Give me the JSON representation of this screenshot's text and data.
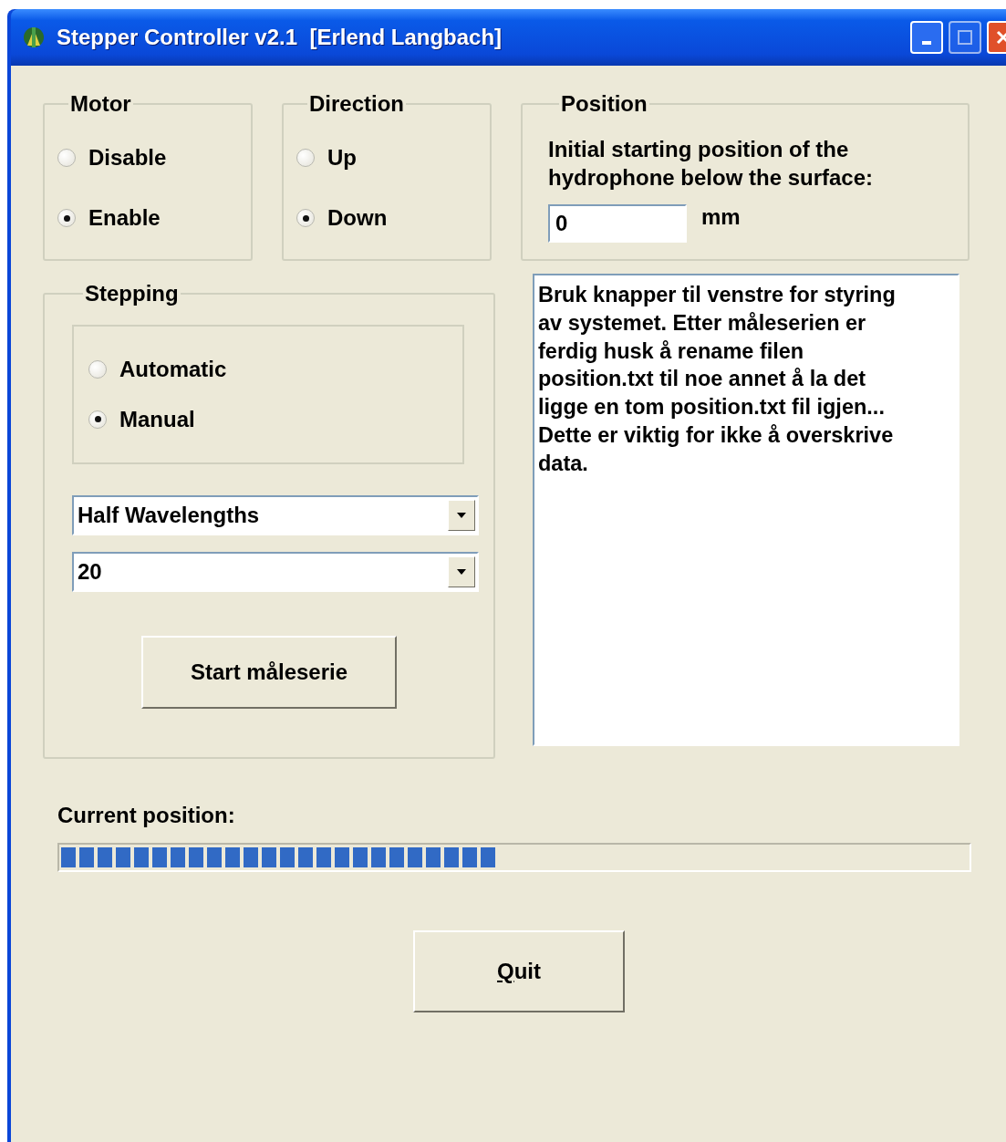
{
  "window": {
    "title": "Stepper Controller v2.1  [Erlend Langbach]"
  },
  "motor": {
    "label": "Motor",
    "options": [
      {
        "label": "Disable",
        "selected": false
      },
      {
        "label": "Enable",
        "selected": true
      }
    ]
  },
  "direction": {
    "label": "Direction",
    "options": [
      {
        "label": "Up",
        "selected": false
      },
      {
        "label": "Down",
        "selected": true
      }
    ]
  },
  "position": {
    "label": "Position",
    "description": "Initial starting position of the\nhydrophone below the surface:",
    "value": "0",
    "unit": "mm"
  },
  "stepping": {
    "label": "Stepping",
    "options": [
      {
        "label": "Automatic",
        "selected": false
      },
      {
        "label": "Manual",
        "selected": true
      }
    ],
    "mode_value": "Half Wavelengths",
    "count_value": "20",
    "start_button": "Start måleserie"
  },
  "info_text": "Bruk knapper til venstre for styring\nav systemet. Etter måleserien er\nferdig husk å rename filen\nposition.txt til noe annet å la det\nligge en tom position.txt fil igjen...\nDette er viktig for ikke å overskrive\ndata.",
  "current_position": {
    "label": "Current position:",
    "level": 0.48
  },
  "quit_button": {
    "label": "Quit",
    "mnemonic_first": true
  }
}
